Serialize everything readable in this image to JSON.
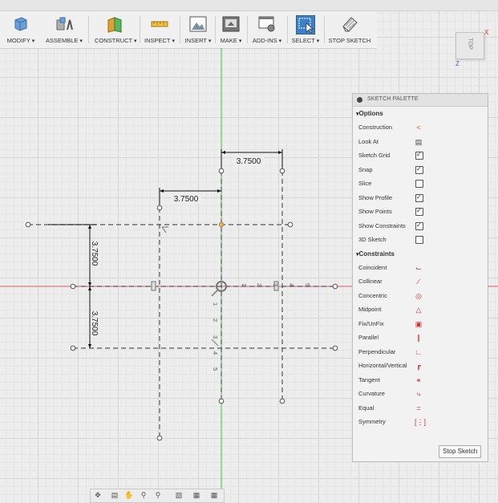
{
  "toolbar": {
    "groups": [
      {
        "label": "MODIFY"
      },
      {
        "label": "ASSEMBLE"
      },
      {
        "label": "CONSTRUCT"
      },
      {
        "label": "INSPECT"
      },
      {
        "label": "INSERT"
      },
      {
        "label": "MAKE"
      },
      {
        "label": "ADD-INS"
      },
      {
        "label": "SELECT"
      },
      {
        "label": "STOP SKETCH"
      }
    ]
  },
  "viewcube": {
    "face": "TOP",
    "x_axis": "X",
    "z_axis": "Z"
  },
  "sketch": {
    "dimensions": [
      "3.7500",
      "3.7500",
      "3.7500",
      "3.7500"
    ],
    "colors": {
      "y_axis": "#3fbf3f",
      "x_axis": "#e06060",
      "lines": "#555555"
    }
  },
  "palette": {
    "title": "SKETCH PALETTE",
    "options_header": "Options",
    "options": [
      {
        "label": "Construction",
        "type": "icon",
        "icon": "construction-icon"
      },
      {
        "label": "Look At",
        "type": "icon",
        "icon": "look-at-icon"
      },
      {
        "label": "Sketch Grid",
        "type": "checkbox",
        "checked": true
      },
      {
        "label": "Snap",
        "type": "checkbox",
        "checked": true
      },
      {
        "label": "Slice",
        "type": "checkbox",
        "checked": false
      },
      {
        "label": "Show Profile",
        "type": "checkbox",
        "checked": true
      },
      {
        "label": "Show Points",
        "type": "checkbox",
        "checked": true
      },
      {
        "label": "Show Constraints",
        "type": "checkbox",
        "checked": true
      },
      {
        "label": "3D Sketch",
        "type": "checkbox",
        "checked": false
      }
    ],
    "constraints_header": "Constraints",
    "constraints": [
      {
        "label": "Coincident",
        "icon": "coincident-icon"
      },
      {
        "label": "Collinear",
        "icon": "collinear-icon"
      },
      {
        "label": "Concentric",
        "icon": "concentric-icon"
      },
      {
        "label": "Midpoint",
        "icon": "midpoint-icon"
      },
      {
        "label": "Fix/UnFix",
        "icon": "fix-icon"
      },
      {
        "label": "Parallel",
        "icon": "parallel-icon"
      },
      {
        "label": "Perpendicular",
        "icon": "perpendicular-icon"
      },
      {
        "label": "Horizontal/Vertical",
        "icon": "horizontal-vertical-icon"
      },
      {
        "label": "Tangent",
        "icon": "tangent-icon"
      },
      {
        "label": "Curvature",
        "icon": "curvature-icon"
      },
      {
        "label": "Equal",
        "icon": "equal-icon"
      },
      {
        "label": "Symmetry",
        "icon": "symmetry-icon"
      }
    ],
    "stop_button": "Stop Sketch"
  }
}
